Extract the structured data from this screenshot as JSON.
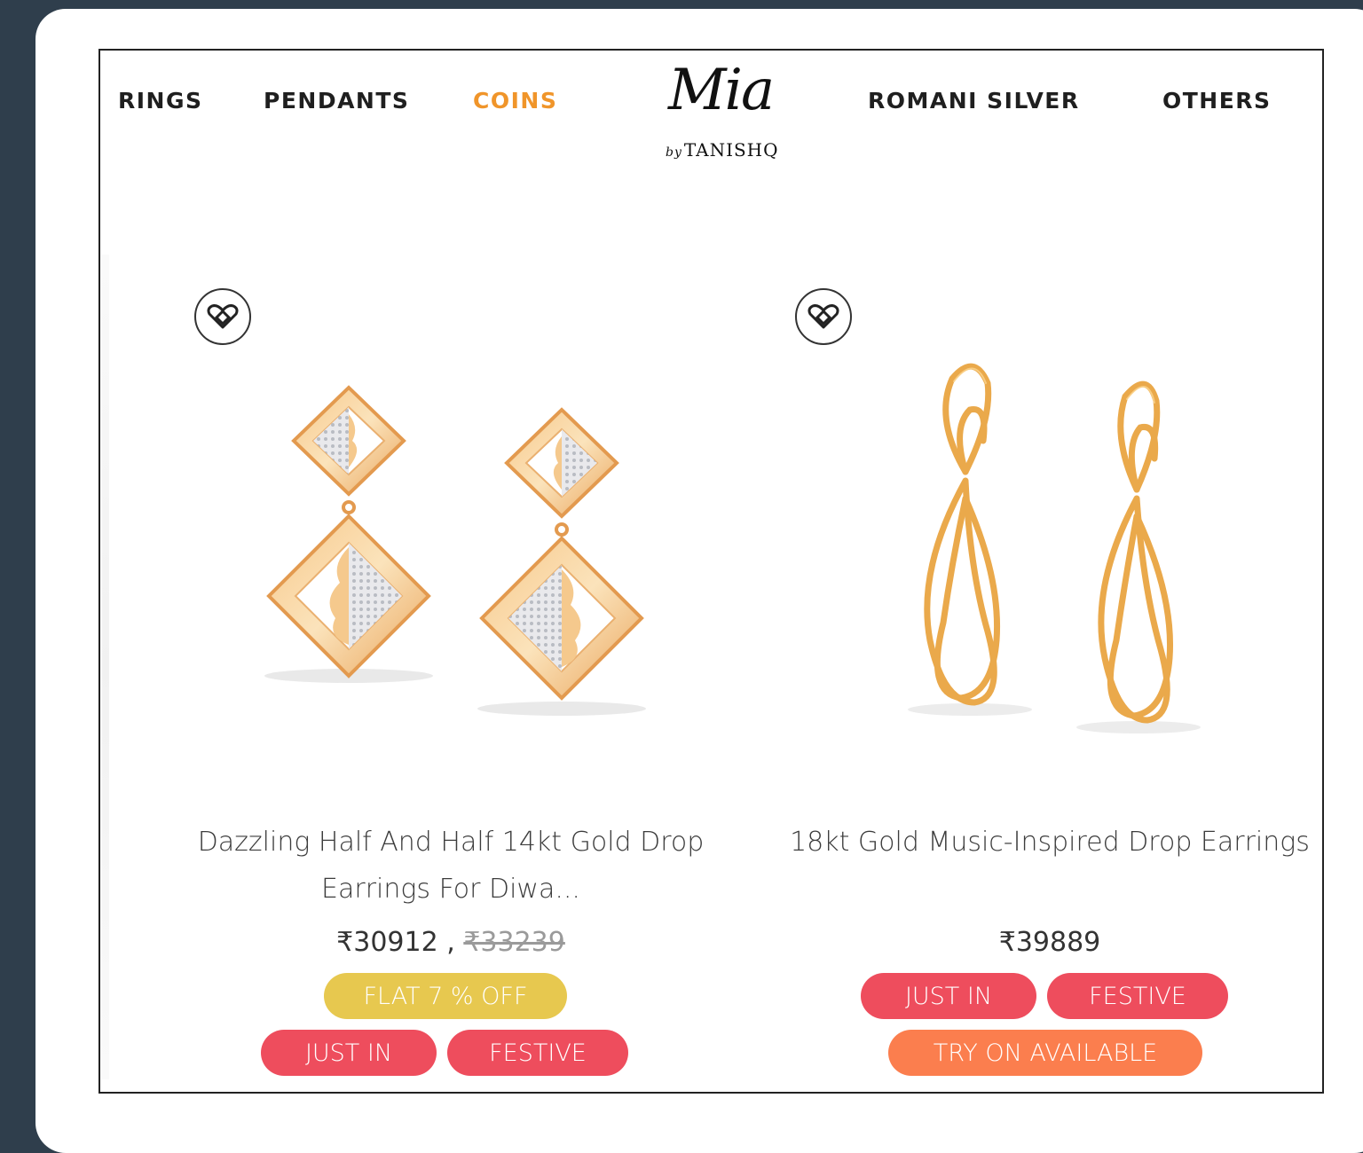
{
  "nav": {
    "items": [
      {
        "label": "RINGS"
      },
      {
        "label": "PENDANTS"
      },
      {
        "label": "COINS"
      },
      {
        "label": "ROMANI SILVER"
      },
      {
        "label": "OTHERS"
      }
    ],
    "active_color": "#f0952a"
  },
  "logo": {
    "script": "Mia",
    "sub_by": "by",
    "sub": "TANISHQ"
  },
  "products": [
    {
      "title": "Dazzling Half And Half 14kt Gold Drop Earrings For Diwa...",
      "price": "₹30912",
      "price_sep": ",",
      "old_price": "₹33239",
      "tags": [
        "FLAT 7 % OFF",
        "JUST IN",
        "FESTIVE"
      ],
      "wishlist_icon": "heart-diamond-icon"
    },
    {
      "title": "18kt Gold Music-Inspired Drop Earrings",
      "price": "₹39889",
      "tags": [
        "JUST IN",
        "FESTIVE",
        "TRY ON AVAILABLE"
      ],
      "wishlist_icon": "heart-diamond-icon"
    }
  ],
  "colors": {
    "tag_red": "#ee4d5d",
    "tag_yellow": "#e7c84f",
    "tag_orange": "#fb7e4e",
    "background": "#2f3e4c"
  }
}
